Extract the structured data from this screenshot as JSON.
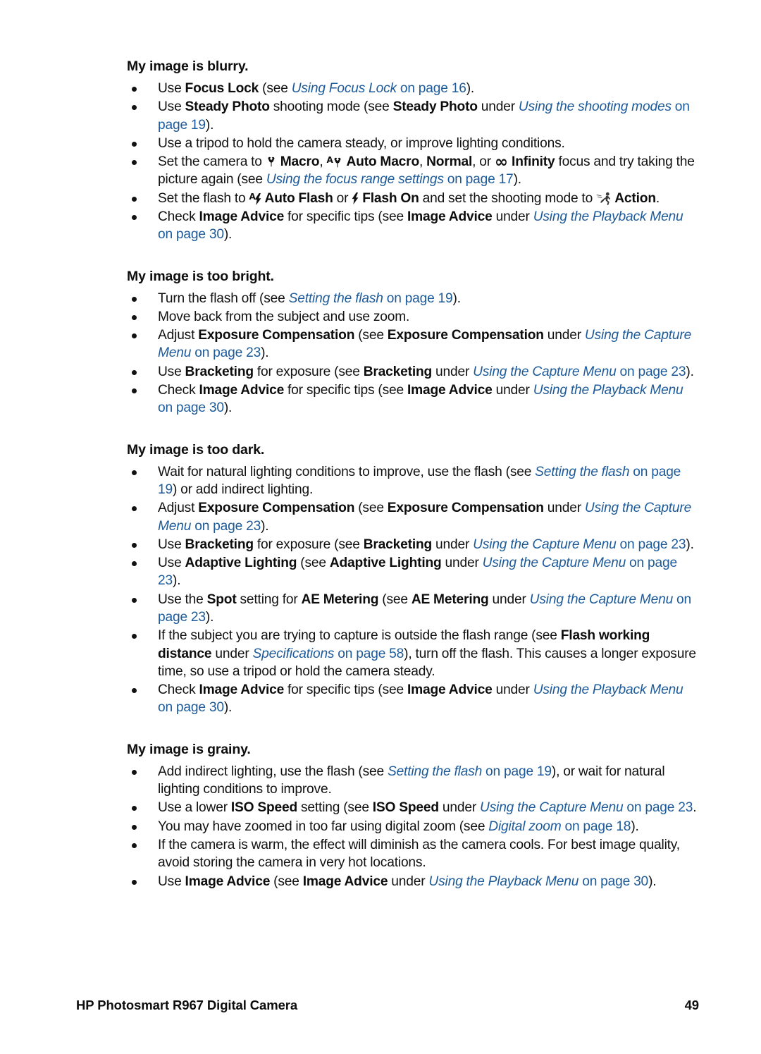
{
  "document": {
    "footer": {
      "title": "HP Photosmart R967 Digital Camera",
      "page_number": "49"
    },
    "link_color": "#1d5a99",
    "text_color": "#111111"
  },
  "sections": [
    {
      "heading": "My image is blurry.",
      "bullets": [
        {
          "id": "focus-lock",
          "parts": [
            {
              "t": "plain",
              "v": "Use "
            },
            {
              "t": "bold",
              "v": "Focus Lock"
            },
            {
              "t": "plain",
              "v": " (see "
            },
            {
              "t": "link",
              "v": "Using Focus Lock"
            },
            {
              "t": "link-plain",
              "v": " on page 16"
            },
            {
              "t": "plain",
              "v": ")."
            }
          ]
        },
        {
          "id": "steady-photo",
          "parts": [
            {
              "t": "plain",
              "v": "Use "
            },
            {
              "t": "bold",
              "v": "Steady Photo"
            },
            {
              "t": "plain",
              "v": " shooting mode (see "
            },
            {
              "t": "bold",
              "v": "Steady Photo"
            },
            {
              "t": "plain",
              "v": " under "
            },
            {
              "t": "link",
              "v": "Using the shooting modes"
            },
            {
              "t": "link-plain",
              "v": " on page 19"
            },
            {
              "t": "plain",
              "v": ")."
            }
          ]
        },
        {
          "id": "tripod",
          "parts": [
            {
              "t": "plain",
              "v": "Use a tripod to hold the camera steady, or improve lighting conditions."
            }
          ]
        },
        {
          "id": "focus-range",
          "parts": [
            {
              "t": "plain",
              "v": "Set the camera to "
            },
            {
              "t": "icon",
              "v": "macro-icon"
            },
            {
              "t": "bold",
              "v": " Macro"
            },
            {
              "t": "plain",
              "v": ", "
            },
            {
              "t": "icon",
              "v": "auto-macro-icon"
            },
            {
              "t": "bold",
              "v": " Auto Macro"
            },
            {
              "t": "plain",
              "v": ", "
            },
            {
              "t": "bold",
              "v": "Normal"
            },
            {
              "t": "plain",
              "v": ", or "
            },
            {
              "t": "icon",
              "v": "infinity-icon"
            },
            {
              "t": "bold",
              "v": " Infinity"
            },
            {
              "t": "plain",
              "v": " focus and try taking the picture again (see "
            },
            {
              "t": "link",
              "v": "Using the focus range settings"
            },
            {
              "t": "link-plain",
              "v": " on page 17"
            },
            {
              "t": "plain",
              "v": ")."
            }
          ]
        },
        {
          "id": "flash-action",
          "parts": [
            {
              "t": "plain",
              "v": "Set the flash to "
            },
            {
              "t": "icon",
              "v": "auto-flash-icon"
            },
            {
              "t": "bold",
              "v": " Auto Flash"
            },
            {
              "t": "plain",
              "v": " or "
            },
            {
              "t": "icon",
              "v": "flash-on-icon"
            },
            {
              "t": "bold",
              "v": " Flash On"
            },
            {
              "t": "plain",
              "v": " and set the shooting mode to "
            },
            {
              "t": "icon",
              "v": "action-icon"
            },
            {
              "t": "bold",
              "v": " Action"
            },
            {
              "t": "plain",
              "v": "."
            }
          ]
        },
        {
          "id": "image-advice-blurry",
          "parts": [
            {
              "t": "plain",
              "v": "Check  "
            },
            {
              "t": "bold",
              "v": "Image Advice"
            },
            {
              "t": "plain",
              "v": " for specific tips (see "
            },
            {
              "t": "bold",
              "v": "Image Advice"
            },
            {
              "t": "plain",
              "v": " under "
            },
            {
              "t": "link",
              "v": "Using the Playback Menu"
            },
            {
              "t": "link-plain",
              "v": " on page 30"
            },
            {
              "t": "plain",
              "v": ")."
            }
          ]
        }
      ]
    },
    {
      "heading": "My image is too bright.",
      "bullets": [
        {
          "id": "flash-off",
          "parts": [
            {
              "t": "plain",
              "v": "Turn the flash off (see "
            },
            {
              "t": "link",
              "v": "Setting the flash"
            },
            {
              "t": "link-plain",
              "v": " on page 19"
            },
            {
              "t": "plain",
              "v": ")."
            }
          ]
        },
        {
          "id": "move-back",
          "parts": [
            {
              "t": "plain",
              "v": "Move back from the subject and use zoom."
            }
          ]
        },
        {
          "id": "exposure-compensation-bright",
          "parts": [
            {
              "t": "plain",
              "v": "Adjust "
            },
            {
              "t": "bold",
              "v": "Exposure Compensation"
            },
            {
              "t": "plain",
              "v": " (see "
            },
            {
              "t": "bold",
              "v": "Exposure Compensation"
            },
            {
              "t": "plain",
              "v": " under "
            },
            {
              "t": "link",
              "v": "Using the Capture Menu"
            },
            {
              "t": "link-plain",
              "v": " on page 23"
            },
            {
              "t": "plain",
              "v": ")."
            }
          ]
        },
        {
          "id": "bracketing-bright",
          "parts": [
            {
              "t": "plain",
              "v": "Use "
            },
            {
              "t": "bold",
              "v": "Bracketing"
            },
            {
              "t": "plain",
              "v": " for exposure (see "
            },
            {
              "t": "bold",
              "v": "Bracketing"
            },
            {
              "t": "plain",
              "v": " under "
            },
            {
              "t": "link",
              "v": "Using the Capture Menu"
            },
            {
              "t": "link-plain",
              "v": " on page 23"
            },
            {
              "t": "plain",
              "v": ")."
            }
          ]
        },
        {
          "id": "image-advice-bright",
          "parts": [
            {
              "t": "plain",
              "v": "Check "
            },
            {
              "t": "bold",
              "v": "Image Advice"
            },
            {
              "t": "plain",
              "v": " for specific tips (see "
            },
            {
              "t": "bold",
              "v": "Image Advice"
            },
            {
              "t": "plain",
              "v": " under "
            },
            {
              "t": "link",
              "v": "Using the Playback Menu"
            },
            {
              "t": "link-plain",
              "v": " on page 30"
            },
            {
              "t": "plain",
              "v": ")."
            }
          ]
        }
      ]
    },
    {
      "heading": "My image is too dark.",
      "bullets": [
        {
          "id": "natural-lighting",
          "parts": [
            {
              "t": "plain",
              "v": "Wait for natural lighting conditions to improve, use the flash (see "
            },
            {
              "t": "link",
              "v": "Setting the flash"
            },
            {
              "t": "link-plain",
              "v": " on page 19"
            },
            {
              "t": "plain",
              "v": ") or add indirect lighting."
            }
          ]
        },
        {
          "id": "exposure-compensation-dark",
          "parts": [
            {
              "t": "plain",
              "v": "Adjust "
            },
            {
              "t": "bold",
              "v": "Exposure Compensation"
            },
            {
              "t": "plain",
              "v": " (see "
            },
            {
              "t": "bold",
              "v": "Exposure Compensation"
            },
            {
              "t": "plain",
              "v": " under "
            },
            {
              "t": "link",
              "v": "Using the Capture Menu"
            },
            {
              "t": "link-plain",
              "v": " on page 23"
            },
            {
              "t": "plain",
              "v": ")."
            }
          ]
        },
        {
          "id": "bracketing-dark",
          "parts": [
            {
              "t": "plain",
              "v": "Use "
            },
            {
              "t": "bold",
              "v": "Bracketing"
            },
            {
              "t": "plain",
              "v": " for exposure (see "
            },
            {
              "t": "bold",
              "v": "Bracketing"
            },
            {
              "t": "plain",
              "v": " under "
            },
            {
              "t": "link",
              "v": "Using the Capture Menu"
            },
            {
              "t": "link-plain",
              "v": " on page 23"
            },
            {
              "t": "plain",
              "v": ")."
            }
          ]
        },
        {
          "id": "adaptive-lighting",
          "parts": [
            {
              "t": "plain",
              "v": "Use "
            },
            {
              "t": "bold",
              "v": "Adaptive Lighting"
            },
            {
              "t": "plain",
              "v": " (see "
            },
            {
              "t": "bold",
              "v": "Adaptive Lighting"
            },
            {
              "t": "plain",
              "v": " under "
            },
            {
              "t": "link",
              "v": "Using the Capture Menu"
            },
            {
              "t": "link-plain",
              "v": " on page 23"
            },
            {
              "t": "plain",
              "v": ")."
            }
          ]
        },
        {
          "id": "ae-metering",
          "parts": [
            {
              "t": "plain",
              "v": "Use the "
            },
            {
              "t": "bold",
              "v": "Spot"
            },
            {
              "t": "plain",
              "v": " setting for "
            },
            {
              "t": "bold",
              "v": "AE Metering"
            },
            {
              "t": "plain",
              "v": " (see "
            },
            {
              "t": "bold",
              "v": "AE Metering"
            },
            {
              "t": "plain",
              "v": " under "
            },
            {
              "t": "link",
              "v": "Using the Capture Menu"
            },
            {
              "t": "link-plain",
              "v": " on page 23"
            },
            {
              "t": "plain",
              "v": ")."
            }
          ]
        },
        {
          "id": "flash-range",
          "parts": [
            {
              "t": "plain",
              "v": "If the subject you are trying to capture is outside the flash range (see "
            },
            {
              "t": "bold",
              "v": "Flash working distance"
            },
            {
              "t": "plain",
              "v": " under "
            },
            {
              "t": "link",
              "v": "Specifications"
            },
            {
              "t": "link-plain",
              "v": " on page 58"
            },
            {
              "t": "plain",
              "v": "), turn off the flash. This causes a longer exposure time, so use a tripod or hold the camera steady."
            }
          ]
        },
        {
          "id": "image-advice-dark",
          "parts": [
            {
              "t": "plain",
              "v": "Check "
            },
            {
              "t": "bold",
              "v": "Image Advice"
            },
            {
              "t": "plain",
              "v": " for specific tips (see "
            },
            {
              "t": "bold",
              "v": "Image Advice"
            },
            {
              "t": "plain",
              "v": " under "
            },
            {
              "t": "link",
              "v": "Using the Playback Menu"
            },
            {
              "t": "link-plain",
              "v": " on page 30"
            },
            {
              "t": "plain",
              "v": ")."
            }
          ]
        }
      ]
    },
    {
      "heading": "My image is grainy.",
      "bullets": [
        {
          "id": "indirect-lighting",
          "parts": [
            {
              "t": "plain",
              "v": "Add indirect lighting, use the flash (see "
            },
            {
              "t": "link",
              "v": "Setting the flash"
            },
            {
              "t": "link-plain",
              "v": " on page 19"
            },
            {
              "t": "plain",
              "v": "), or wait for natural lighting conditions to improve."
            }
          ]
        },
        {
          "id": "iso-speed",
          "parts": [
            {
              "t": "plain",
              "v": "Use a lower "
            },
            {
              "t": "bold",
              "v": "ISO Speed"
            },
            {
              "t": "plain",
              "v": " setting (see "
            },
            {
              "t": "bold",
              "v": "ISO Speed"
            },
            {
              "t": "plain",
              "v": " under "
            },
            {
              "t": "link",
              "v": "Using the Capture Menu"
            },
            {
              "t": "link-plain",
              "v": " on page 23"
            },
            {
              "t": "plain",
              "v": "."
            }
          ]
        },
        {
          "id": "digital-zoom",
          "parts": [
            {
              "t": "plain",
              "v": "You may have zoomed in too far using digital zoom (see "
            },
            {
              "t": "link",
              "v": "Digital zoom"
            },
            {
              "t": "link-plain",
              "v": " on page 18"
            },
            {
              "t": "plain",
              "v": ")."
            }
          ]
        },
        {
          "id": "camera-warm",
          "parts": [
            {
              "t": "plain",
              "v": "If the camera is warm, the effect will diminish as the camera cools. For best image quality, avoid storing the camera in very hot locations."
            }
          ]
        },
        {
          "id": "image-advice-grainy",
          "parts": [
            {
              "t": "plain",
              "v": "Use "
            },
            {
              "t": "bold",
              "v": "Image Advice"
            },
            {
              "t": "plain",
              "v": " (see "
            },
            {
              "t": "bold",
              "v": "Image Advice"
            },
            {
              "t": "plain",
              "v": " under "
            },
            {
              "t": "link",
              "v": "Using the Playback Menu"
            },
            {
              "t": "link-plain",
              "v": " on page 30"
            },
            {
              "t": "plain",
              "v": ")."
            }
          ]
        }
      ]
    }
  ]
}
